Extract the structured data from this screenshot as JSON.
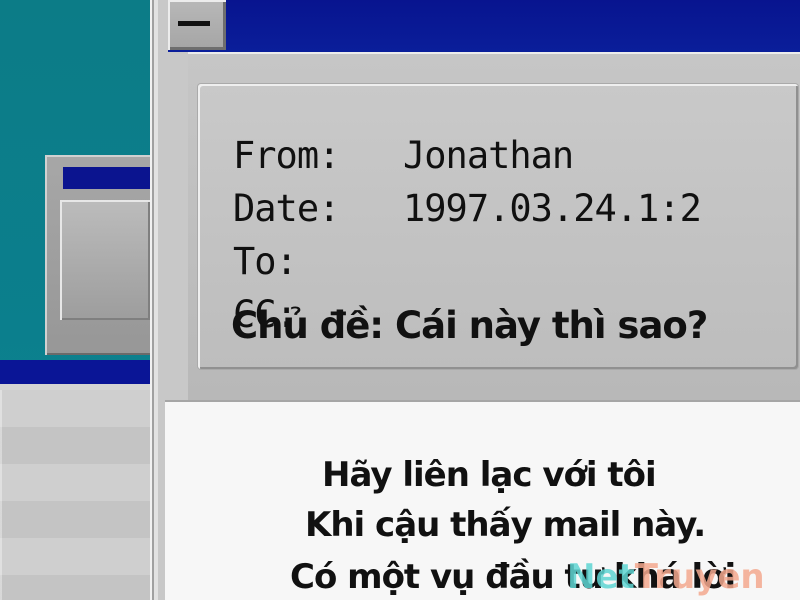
{
  "header": {
    "from_label": "From:",
    "from_value": "Jonathan",
    "date_label": "Date:",
    "date_value": "1997.03.24.1:2",
    "to_label": "To:",
    "cc_label": "CC:",
    "subject": "Chủ đề: Cái này thì sao?"
  },
  "body": {
    "line1": "Hãy liên lạc với tôi",
    "line2": "Khi cậu thấy mail này.",
    "line3": "Có một vụ đầu tư khá lời"
  },
  "watermark": {
    "part1": "Net",
    "part2": "Truyen"
  },
  "colors": {
    "desktop": "#0f7f8f",
    "title_bar": "#08148f",
    "window_gray": "#c8c8c8",
    "watermark_teal": "#5fd6d3",
    "watermark_peach": "#f4a98f"
  },
  "icons": {
    "minimize": "minimize-icon"
  }
}
